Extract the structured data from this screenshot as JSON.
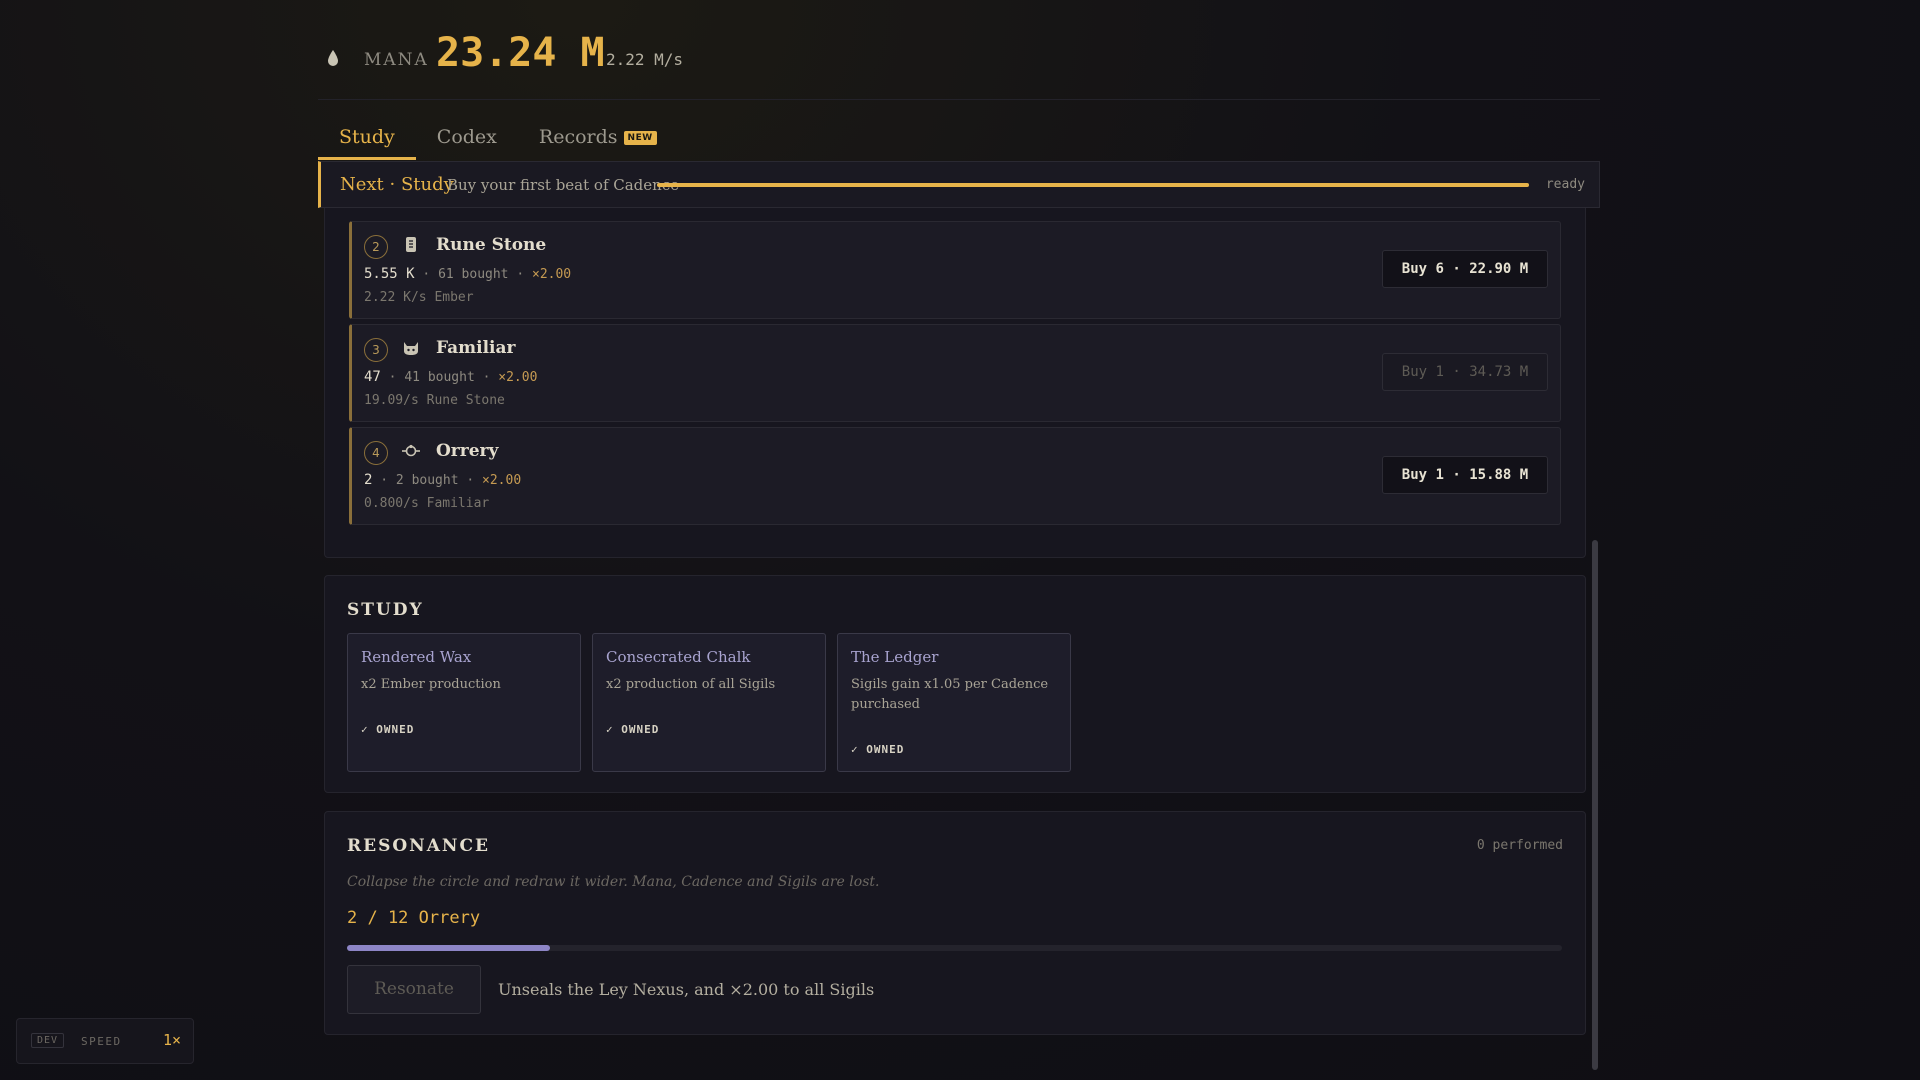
{
  "header": {
    "resource_icon": "droplet-icon",
    "resource_label": "MANA",
    "resource_value": "23.24 M",
    "resource_rate": "2.22 M/s"
  },
  "tabs": [
    {
      "label": "Study",
      "active": true
    },
    {
      "label": "Codex",
      "active": false
    },
    {
      "label": "Records",
      "active": false,
      "badge": "NEW"
    }
  ],
  "next_banner": {
    "title": "Next · Study",
    "description": "Buy your first beat of Cadence",
    "progress": 1.0,
    "status": "ready"
  },
  "sigils": [
    {
      "index": "2",
      "icon": "rune-stone-icon",
      "name": "Rune Stone",
      "amount": "5.55 K",
      "bought": "61 bought",
      "mult": "×2.00",
      "rate": "2.22 K/s Ember",
      "buy_label": "Buy 6 · 22.90 M",
      "affordable": true
    },
    {
      "index": "3",
      "icon": "cat-icon",
      "name": "Familiar",
      "amount": "47",
      "bought": "41 bought",
      "mult": "×2.00",
      "rate": "19.09/s Rune Stone",
      "buy_label": "Buy 1 · 34.73 M",
      "affordable": false
    },
    {
      "index": "4",
      "icon": "orrery-icon",
      "name": "Orrery",
      "amount": "2",
      "bought": "2 bought",
      "mult": "×2.00",
      "rate": "0.800/s Familiar",
      "buy_label": "Buy 1 · 15.88 M",
      "affordable": true
    }
  ],
  "study": {
    "title": "STUDY",
    "cards": [
      {
        "name": "Rendered Wax",
        "description": "x2 Ember production",
        "status": "✓ OWNED"
      },
      {
        "name": "Consecrated Chalk",
        "description": "x2 production of all Sigils",
        "status": "✓ OWNED"
      },
      {
        "name": "The Ledger",
        "description": "Sigils gain x1.05 per Cadence purchased",
        "status": "✓ OWNED"
      }
    ]
  },
  "resonance": {
    "title": "RESONANCE",
    "performed": "0 performed",
    "description": "Collapse the circle and redraw it wider. Mana, Cadence and Sigils are lost.",
    "progress_text": "2 / 12 Orrery",
    "progress": 0.1667,
    "button_label": "Resonate",
    "reward": "Unseals the Ley Nexus, and ×2.00 to all Sigils"
  },
  "dev": {
    "tag": "DEV",
    "speed_label": "SPEED",
    "multiplier": "1×"
  },
  "colors": {
    "accent": "#e6b34a",
    "resonance_fill": "#8d85c6",
    "background": "#121116"
  }
}
